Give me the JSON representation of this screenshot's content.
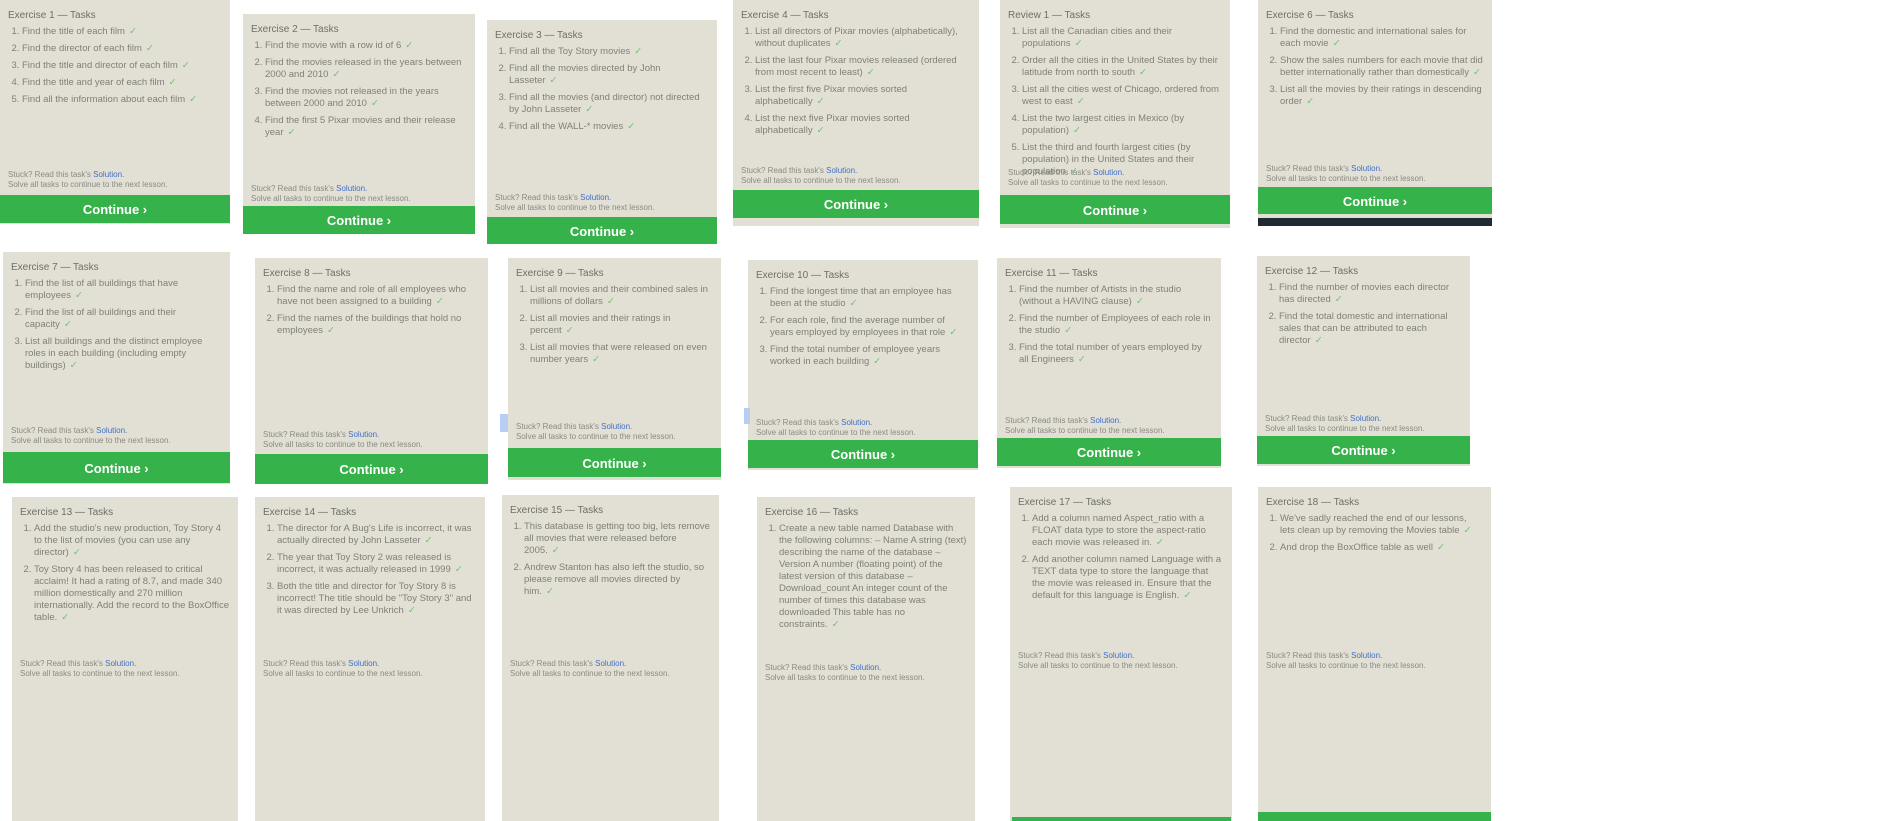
{
  "footer": {
    "stuck_text": "Stuck? Read this task's",
    "solution_link": "Solution.",
    "solve_text": "Solve all tasks to continue to the next lesson."
  },
  "continue_label": "Continue ›",
  "check_mark": "✓",
  "cards": [
    {
      "title": "Exercise 1 — Tasks",
      "tasks": [
        "Find the title of each film",
        "Find the director of each film",
        "Find the title and director of each film",
        "Find the title and year of each film",
        "Find all the information about each film"
      ]
    },
    {
      "title": "Exercise 2 — Tasks",
      "tasks": [
        "Find the movie with a row id of 6",
        "Find the movies released in the years between 2000 and 2010",
        "Find the movies not released in the years between 2000 and 2010",
        "Find the first 5 Pixar movies and their release year"
      ]
    },
    {
      "title": "Exercise 3 — Tasks",
      "tasks": [
        "Find all the Toy Story movies",
        "Find all the movies directed by John Lasseter",
        "Find all the movies (and director) not directed by John Lasseter",
        "Find all the WALL-* movies"
      ]
    },
    {
      "title": "Exercise 4 — Tasks",
      "tasks": [
        "List all directors of Pixar movies (alphabetically), without duplicates",
        "List the last four Pixar movies released (ordered from most recent to least)",
        "List the first five Pixar movies sorted alphabetically",
        "List the next five Pixar movies sorted alphabetically"
      ]
    },
    {
      "title": "Review 1 — Tasks",
      "tasks": [
        "List all the Canadian cities and their populations",
        "Order all the cities in the United States by their latitude from north to south",
        "List all the cities west of Chicago, ordered from west to east",
        "List the two largest cities in Mexico (by population)",
        "List the third and fourth largest cities (by population) in the United States and their population"
      ]
    },
    {
      "title": "Exercise 6 — Tasks",
      "tasks": [
        "Find the domestic and international sales for each movie",
        "Show the sales numbers for each movie that did better internationally rather than domestically",
        "List all the movies by their ratings in descending order"
      ]
    },
    {
      "title": "Exercise 7 — Tasks",
      "tasks": [
        "Find the list of all buildings that have employees",
        "Find the list of all buildings and their capacity",
        "List all buildings and the distinct employee roles in each building (including empty buildings)"
      ]
    },
    {
      "title": "Exercise 8 — Tasks",
      "tasks": [
        "Find the name and role of all employees who have not been assigned to a building",
        "Find the names of the buildings that hold no employees"
      ]
    },
    {
      "title": "Exercise 9 — Tasks",
      "tasks": [
        "List all movies and their combined sales in millions of dollars",
        "List all movies and their ratings in percent",
        "List all movies that were released on even number years"
      ]
    },
    {
      "title": "Exercise 10 — Tasks",
      "tasks": [
        "Find the longest time that an employee has been at the studio",
        "For each role, find the average number of years employed by employees in that role",
        "Find the total number of employee years worked in each building"
      ]
    },
    {
      "title": "Exercise 11 — Tasks",
      "tasks": [
        "Find the number of Artists in the studio (without a HAVING clause)",
        "Find the number of Employees of each role in the studio",
        "Find the total number of years employed by all Engineers"
      ]
    },
    {
      "title": "Exercise 12 — Tasks",
      "tasks": [
        "Find the number of movies each director has directed",
        "Find the total domestic and international sales that can be attributed to each director"
      ]
    },
    {
      "title": "Exercise 13 — Tasks",
      "tasks": [
        "Add the studio's new production, Toy Story 4 to the list of movies (you can use any director)",
        "Toy Story 4 has been released to critical acclaim! It had a rating of 8.7, and made 340 million domestically and 270 million internationally. Add the record to the BoxOffice table."
      ]
    },
    {
      "title": "Exercise 14 — Tasks",
      "tasks": [
        "The director for A Bug's Life is incorrect, it was actually directed by John Lasseter",
        "The year that Toy Story 2 was released is incorrect, it was actually released in 1999",
        "Both the title and director for Toy Story 8 is incorrect! The title should be \"Toy Story 3\" and it was directed by Lee Unkrich"
      ]
    },
    {
      "title": "Exercise 15 — Tasks",
      "tasks": [
        "This database is getting too big, lets remove all movies that were released before 2005.",
        "Andrew Stanton has also left the studio, so please remove all movies directed by him."
      ]
    },
    {
      "title": "Exercise 16 — Tasks",
      "tasks": [
        "Create a new table named Database with the following columns: – Name A string (text) describing the name of the database – Version A number (floating point) of the latest version of this database – Download_count An integer count of the number of times this database was downloaded This table has no constraints."
      ]
    },
    {
      "title": "Exercise 17 — Tasks",
      "tasks": [
        "Add a column named Aspect_ratio with a FLOAT data type to store the aspect-ratio each movie was released in.",
        "Add another column named Language with a TEXT data type to store the language that the movie was released in. Ensure that the default for this language is English."
      ]
    },
    {
      "title": "Exercise 18 — Tasks",
      "tasks": [
        "We've sadly reached the end of our lessons, lets clean up by removing the Movies table",
        "And drop the BoxOffice table as well"
      ]
    }
  ]
}
